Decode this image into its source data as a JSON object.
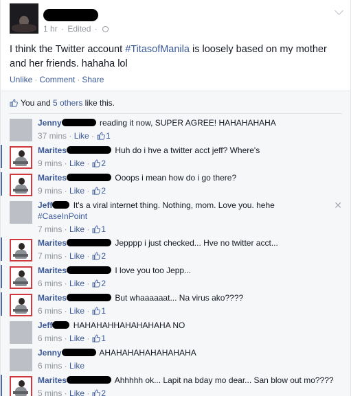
{
  "post": {
    "time": "1 hr",
    "edited": "Edited",
    "text_before": "I think the Twitter account ",
    "hashtag": "#TitasofManila",
    "text_after": " is loosely based on my mother and her friends. hahaha lol",
    "actions": {
      "unlike": "Unlike",
      "comment": "Comment",
      "share": "Share"
    }
  },
  "likes": {
    "you": "You and ",
    "others": "5 others",
    "suffix": " like this."
  },
  "comments": [
    {
      "name": "Jenny",
      "text": "reading it now, SUPER AGREE! HAHAHAHAHA",
      "time": "37 mins",
      "like": "Like",
      "count": "1"
    },
    {
      "name": "Marites",
      "text": "Huh do i hve a twitter acct jeff? Where's",
      "time": "9 mins",
      "like": "Like",
      "count": "2"
    },
    {
      "name": "Marites",
      "text": "Ooops i mean how do i go there?",
      "time": "9 mins",
      "like": "Like",
      "count": "2"
    },
    {
      "name": "Jeff",
      "text": "It's a viral internet thing. Nothing, mom. Love you. hehe",
      "hashtag": "#CaseInPoint",
      "time": "7 mins",
      "like": "Like",
      "count": "1"
    },
    {
      "name": "Marites",
      "text": "Jepppp i just checked... Hve no twitter acct...",
      "time": "7 mins",
      "like": "Like",
      "count": "2"
    },
    {
      "name": "Marites",
      "text": "I love you too Jepp...",
      "time": "6 mins",
      "like": "Like",
      "count": "2"
    },
    {
      "name": "Marites",
      "text": "But whaaaaaat... Na virus ako????",
      "time": "6 mins",
      "like": "Like",
      "count": "1"
    },
    {
      "name": "Jeff",
      "text": "HAHAHAHHAHAHAHAHA NO",
      "time": "6 mins",
      "like": "Like",
      "count": "1"
    },
    {
      "name": "Jenny",
      "text": "AHAHAHAHAHAHAHAHA",
      "time": "6 mins",
      "like": "Like",
      "count": ""
    },
    {
      "name": "Marites",
      "text": "Ahhhhh ok... Lapit na bday mo dear... San blow out mo????",
      "time": "5 mins",
      "like": "Like",
      "count": "2"
    }
  ],
  "colors": {
    "link": "#3b5998",
    "meta": "#90949c",
    "bar": "#4e69a2",
    "avatar_border": "#d0383d"
  },
  "icons": {
    "like": "thumbs-up-icon",
    "privacy": "globe-icon",
    "menu": "chevron-down-icon",
    "hide": "close-icon"
  }
}
